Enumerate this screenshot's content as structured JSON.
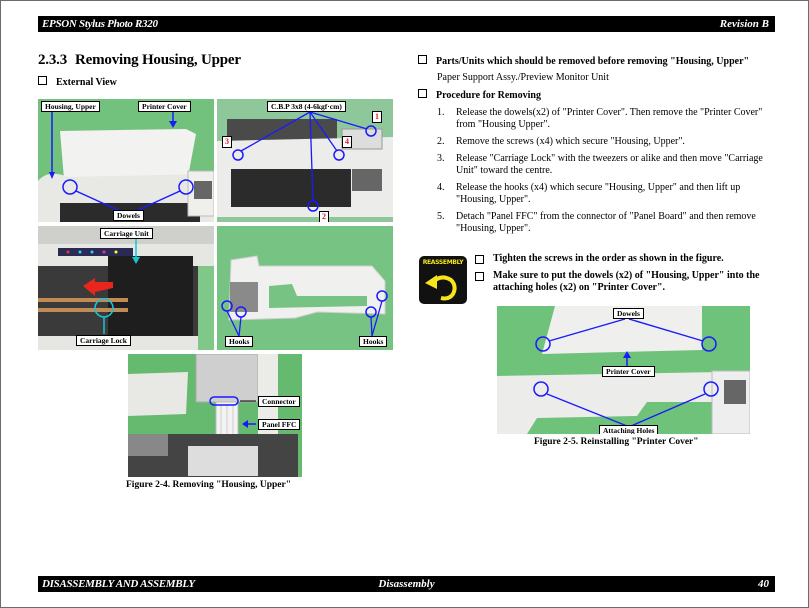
{
  "header": {
    "product": "EPSON Stylus Photo R320",
    "revision": "Revision B"
  },
  "footer": {
    "chapter": "DISASSEMBLY AND ASSEMBLY",
    "section": "Disassembly",
    "page": "40"
  },
  "section": {
    "number": "2.3.3",
    "title": "Removing Housing, Upper"
  },
  "left": {
    "external_view_heading": "External View",
    "photo1": {
      "labels": [
        "Housing, Upper",
        "Printer Cover",
        "Dowels"
      ]
    },
    "photo2": {
      "label": "C.B.P 3x8 (4-6kgf·cm)",
      "order_marks": [
        "1",
        "2",
        "3",
        "4"
      ]
    },
    "photo3": {
      "labels": [
        "Carriage Unit",
        "Carriage Lock"
      ]
    },
    "photo4": {
      "labels": [
        "Hooks",
        "Hooks"
      ]
    },
    "photo5": {
      "labels": [
        "Connector",
        "Panel FFC"
      ]
    },
    "figure_caption": "Figure 2-4.  Removing \"Housing, Upper\""
  },
  "right": {
    "parts_heading": "Parts/Units which should be removed before removing \"Housing, Upper\"",
    "parts_text": "Paper Support Assy./Preview Monitor Unit",
    "procedure_heading": "Procedure for Removing",
    "steps": [
      {
        "n": "1.",
        "text": "Release the dowels(x2) of \"Printer Cover\". Then remove the \"Printer Cover\" from \"Housing Upper\"."
      },
      {
        "n": "2.",
        "text": "Remove the screws (x4) which secure \"Housing, Upper\"."
      },
      {
        "n": "3.",
        "text": "Release \"Carriage Lock\" with the tweezers or alike and then move \"Carriage Unit\" toward the centre."
      },
      {
        "n": "4.",
        "text": "Release the hooks (x4) which secure \"Housing, Upper\" and then lift up \"Housing, Upper\"."
      },
      {
        "n": "5.",
        "text": "Detach \"Panel FFC\" from the connector of \"Panel Board\" and then remove \"Housing, Upper\"."
      }
    ],
    "reassembly_icon_text": "REASSEMBLY",
    "notes": [
      "Tighten the screws in the order as shown in the figure.",
      "Make sure to put the dowels (x2) of \"Housing, Upper\" into the attaching holes (x2) on \"Printer Cover\"."
    ],
    "photo6": {
      "labels": [
        "Dowels",
        "Printer Cover",
        "Attaching Holes"
      ]
    },
    "figure_caption": "Figure 2-5.  Reinstalling \"Printer Cover\""
  },
  "colors": {
    "accent_blue": "#1a1aff",
    "cyan": "#19c3d6",
    "red_marks": "#e0142a",
    "reassembly_yellow": "#f5e51a",
    "photo_green": "#6fc27a"
  }
}
